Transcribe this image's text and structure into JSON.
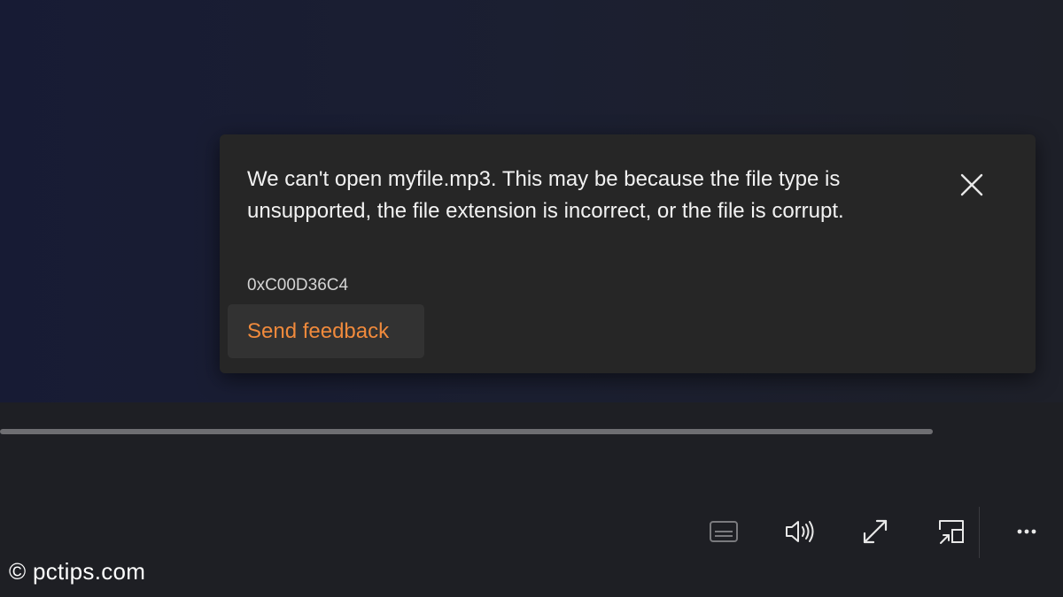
{
  "error_dialog": {
    "message": "We can't open myfile.mp3. This may be because the file type is unsupported, the file extension is incorrect, or the file is corrupt.",
    "code": "0xC00D36C4",
    "feedback_label": "Send feedback",
    "close_icon": "close-icon"
  },
  "player_controls": {
    "progress": 0,
    "icons": [
      "captions-icon",
      "volume-icon",
      "fullscreen-icon",
      "mini-player-icon",
      "more-icon"
    ]
  },
  "watermark": "© pctips.com",
  "colors": {
    "accent": "#f08a3c",
    "card_bg": "#262626",
    "background": "#1a1e30"
  }
}
